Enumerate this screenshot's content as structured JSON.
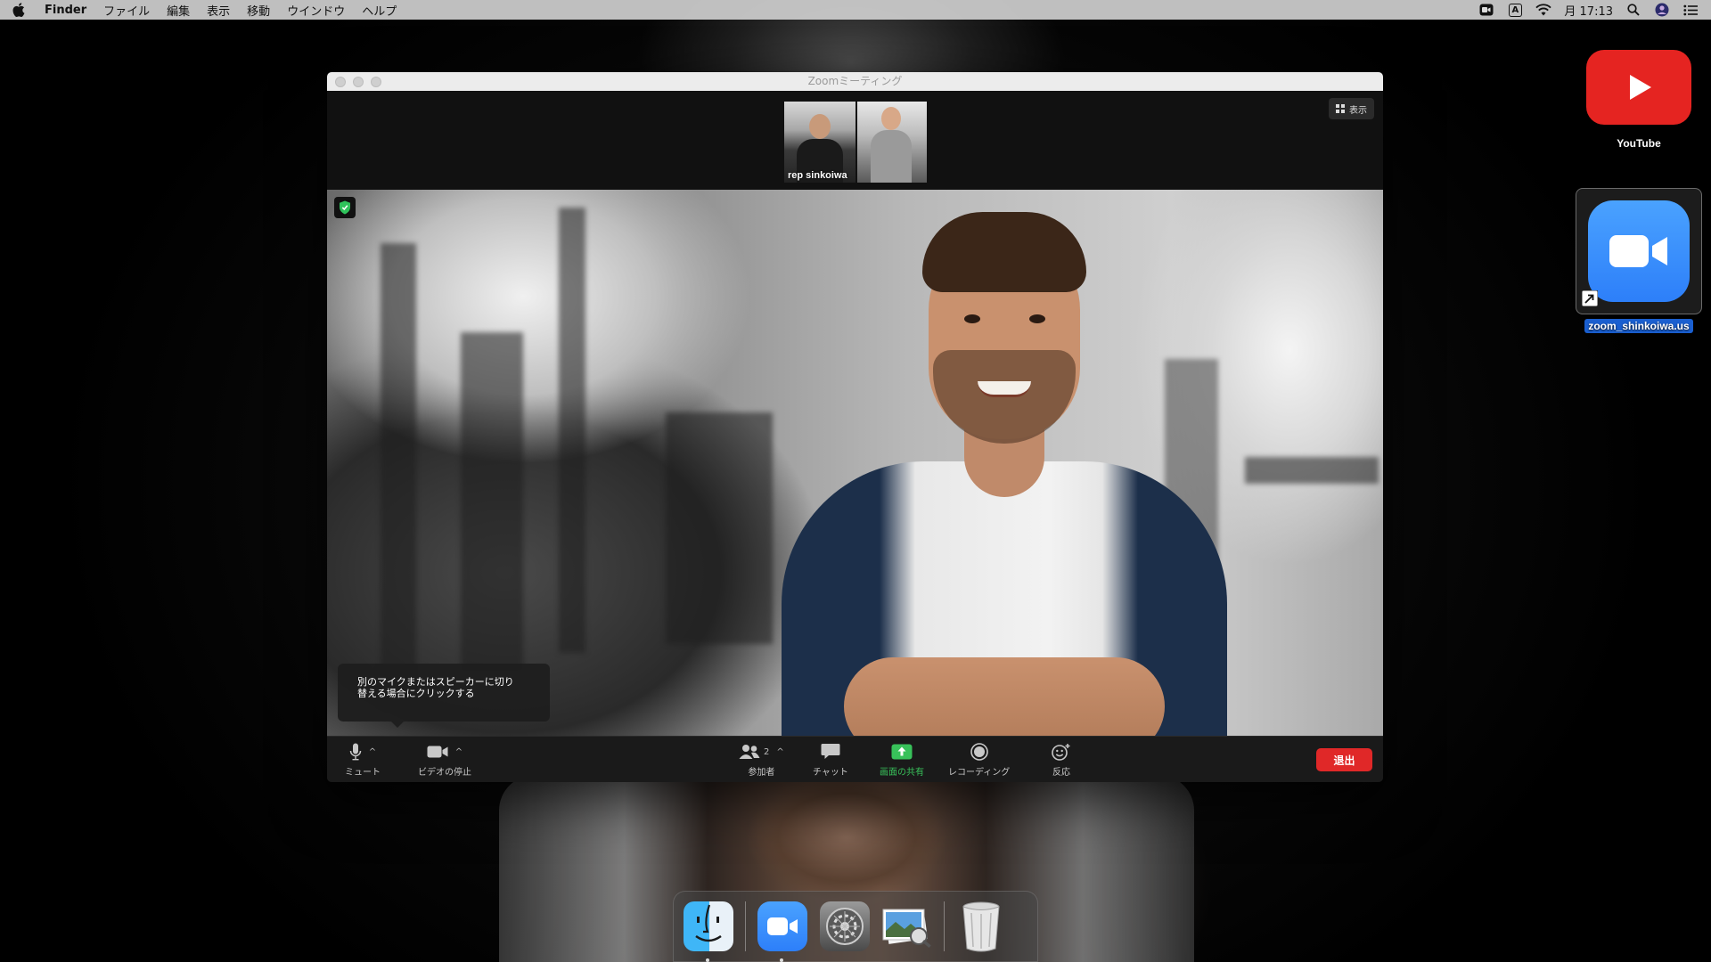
{
  "menubar": {
    "apple_icon": "apple-logo-icon",
    "app_name": "Finder",
    "menus": [
      "ファイル",
      "編集",
      "表示",
      "移動",
      "ウインドウ",
      "ヘルプ"
    ],
    "clock": "月 17:13",
    "input_indicator": "A"
  },
  "zoom": {
    "window_title": "Zoomミーティング",
    "view_button_label": "表示",
    "thumbnail_name": "rep sinkoiwa",
    "tooltip_text": "別のマイクまたはスピーカーに切り替える場合にクリックする",
    "tooltip_line1": "別のマイクまたはスピーカーに切り",
    "tooltip_line2": "替える場合にクリックする",
    "toolbar": {
      "mute_label": "ミュート",
      "video_label": "ビデオの停止",
      "participants_label": "参加者",
      "participants_count": "2",
      "chat_label": "チャット",
      "share_label": "画面の共有",
      "record_label": "レコーディング",
      "reactions_label": "反応",
      "leave_label": "退出"
    },
    "colors": {
      "share_green": "#38c15a",
      "leave_red": "#e02828",
      "security_green": "#2fc25b"
    }
  },
  "desktop": {
    "icons": [
      {
        "label": "YouTube",
        "icon": "youtube-icon"
      },
      {
        "label": "zoom_shinkoiwa.us",
        "icon": "zoom-app-icon",
        "selected": true
      }
    ]
  },
  "dock": {
    "items": [
      {
        "icon": "finder-icon",
        "running": true
      },
      {
        "icon": "zoom-icon",
        "running": true
      },
      {
        "icon": "system-preferences-icon",
        "running": false
      },
      {
        "icon": "preview-icon",
        "running": false
      },
      {
        "icon": "trash-icon",
        "running": false
      }
    ]
  }
}
